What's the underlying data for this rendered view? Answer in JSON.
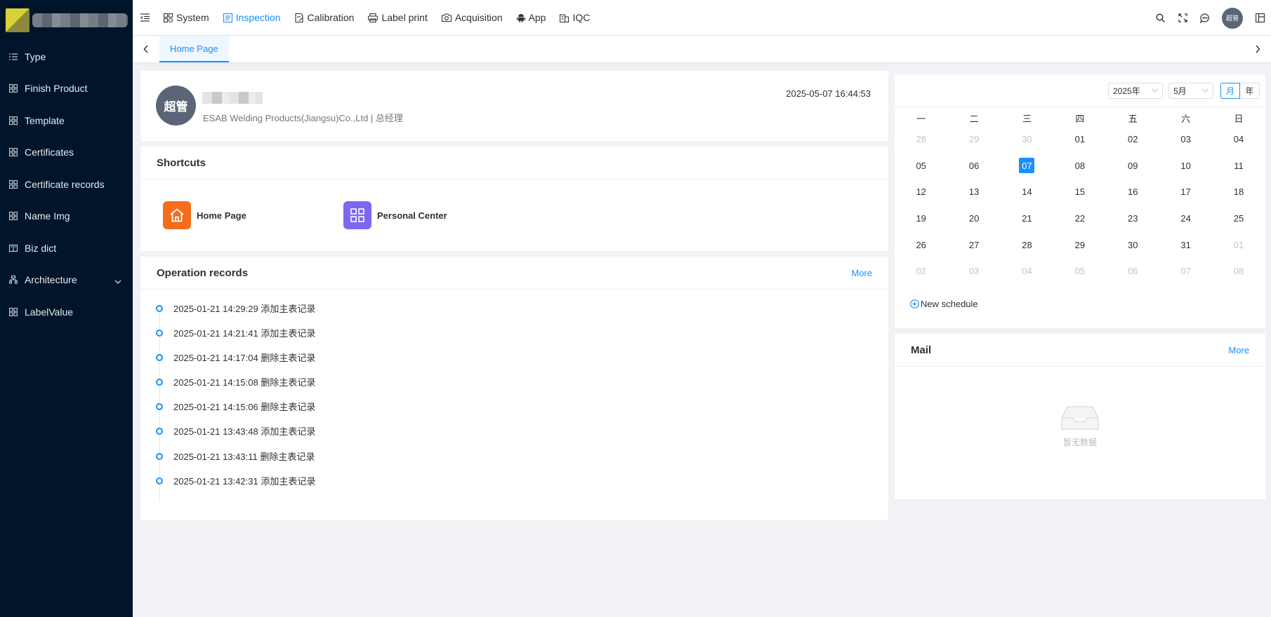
{
  "sidebar": {
    "items": [
      {
        "label": "Type"
      },
      {
        "label": "Finish Product"
      },
      {
        "label": "Template"
      },
      {
        "label": "Certificates"
      },
      {
        "label": "Certificate records"
      },
      {
        "label": "Name Img"
      },
      {
        "label": "Biz dict"
      },
      {
        "label": "Architecture"
      },
      {
        "label": "LabelValue"
      }
    ]
  },
  "topnav": {
    "items": [
      {
        "label": "System"
      },
      {
        "label": "Inspection"
      },
      {
        "label": "Calibration"
      },
      {
        "label": "Label print"
      },
      {
        "label": "Acquisition"
      },
      {
        "label": "App"
      },
      {
        "label": "IQC"
      }
    ],
    "active": "Inspection",
    "avatar_text": "超管"
  },
  "tabs": {
    "home": "Home Page"
  },
  "profile": {
    "avatar_text": "超管",
    "company": "ESAB Welding Products(Jiangsu)Co.,Ltd | 总经理",
    "datetime": "2025-05-07 16:44:53"
  },
  "shortcuts": {
    "title": "Shortcuts",
    "items": [
      {
        "label": "Home Page",
        "color": "#f56c1a"
      },
      {
        "label": "Personal Center",
        "color": "#7b68ee"
      }
    ]
  },
  "operation_records": {
    "title": "Operation records",
    "more": "More",
    "items": [
      "2025-01-21 14:29:29 添加主表记录",
      "2025-01-21 14:21:41 添加主表记录",
      "2025-01-21 14:17:04 删除主表记录",
      "2025-01-21 14:15:08 删除主表记录",
      "2025-01-21 14:15:06 删除主表记录",
      "2025-01-21 13:43:48 添加主表记录",
      "2025-01-21 13:43:11 删除主表记录",
      "2025-01-21 13:42:31 添加主表记录"
    ]
  },
  "calendar": {
    "year": "2025年",
    "month": "5月",
    "mode_month": "月",
    "mode_year": "年",
    "weekdays": [
      "一",
      "二",
      "三",
      "四",
      "五",
      "六",
      "日"
    ],
    "weeks": [
      [
        "28",
        "29",
        "30",
        "01",
        "02",
        "03",
        "04"
      ],
      [
        "05",
        "06",
        "07",
        "08",
        "09",
        "10",
        "11"
      ],
      [
        "12",
        "13",
        "14",
        "15",
        "16",
        "17",
        "18"
      ],
      [
        "19",
        "20",
        "21",
        "22",
        "23",
        "24",
        "25"
      ],
      [
        "26",
        "27",
        "28",
        "29",
        "30",
        "31",
        "01"
      ],
      [
        "02",
        "03",
        "04",
        "05",
        "06",
        "07",
        "08"
      ]
    ],
    "muted": [
      [
        0,
        0
      ],
      [
        0,
        1
      ],
      [
        0,
        2
      ],
      [
        4,
        6
      ],
      [
        5,
        0
      ],
      [
        5,
        1
      ],
      [
        5,
        2
      ],
      [
        5,
        3
      ],
      [
        5,
        4
      ],
      [
        5,
        5
      ],
      [
        5,
        6
      ]
    ],
    "today": [
      1,
      2
    ],
    "new_schedule": "New schedule",
    "accent": "#1890ff"
  },
  "mail": {
    "title": "Mail",
    "more": "More",
    "empty_text": "暂无数据"
  }
}
